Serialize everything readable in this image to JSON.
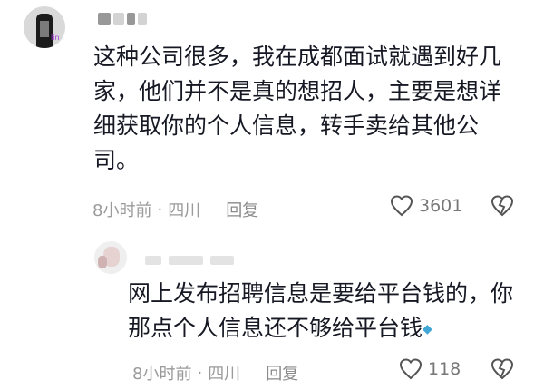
{
  "comments": [
    {
      "text": "这种公司很多，我在成都面试就遇到好几家，他们并不是真的想招人，主要是想详细获取你的个人信息，转手卖给其他公司。",
      "avatar_tag": "lin",
      "time": "8小时前",
      "separator": "·",
      "location": "四川",
      "reply_label": "回复",
      "likes": "3601"
    },
    {
      "text": "网上发布招聘信息是要给平台钱的，你那点个人信息还不够给平台钱",
      "time": "8小时前",
      "separator": "·",
      "location": "四川",
      "reply_label": "回复",
      "likes": "118"
    }
  ],
  "icons": {
    "like": "heart-outline-icon",
    "dislike": "broken-heart-icon"
  }
}
